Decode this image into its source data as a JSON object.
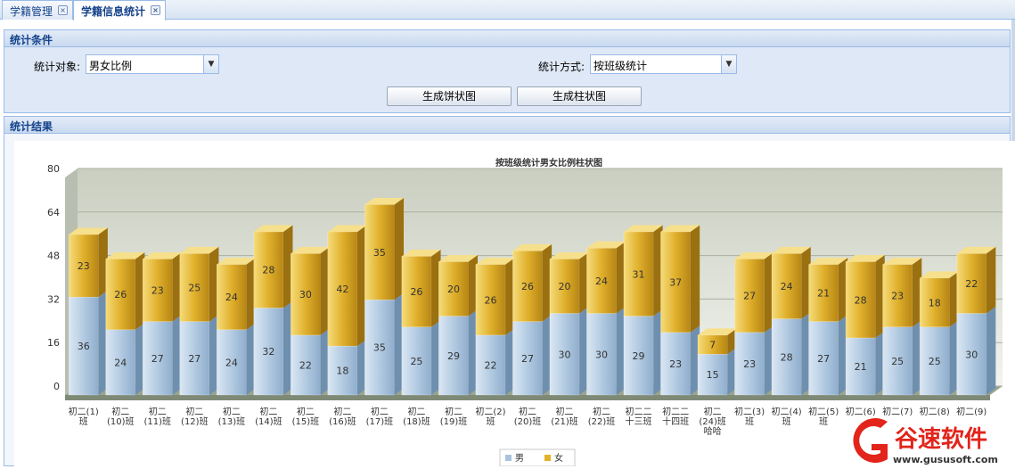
{
  "tabs": [
    {
      "label": "学籍管理",
      "active": false
    },
    {
      "label": "学籍信息统计",
      "active": true
    }
  ],
  "conditions": {
    "header": "统计条件",
    "target_label": "统计对象:",
    "target_value": "男女比例",
    "method_label": "统计方式:",
    "method_value": "按班级统计",
    "pie_button": "生成饼状图",
    "bar_button": "生成柱状图"
  },
  "results": {
    "header": "统计结果"
  },
  "watermark": {
    "text": "谷速软件",
    "url": "www.gususoft.com",
    "color": "#e2241b"
  },
  "chart_data": {
    "type": "bar",
    "stacked": true,
    "title": "按班级统计男女比例柱状图",
    "ylim": [
      0,
      80
    ],
    "yticks": [
      0,
      16,
      32,
      48,
      64,
      80
    ],
    "grid": true,
    "legend_position": "bottom",
    "categories": [
      [
        "初二(1)",
        "班"
      ],
      [
        "初二",
        "(10)班"
      ],
      [
        "初二",
        "(11)班"
      ],
      [
        "初二",
        "(12)班"
      ],
      [
        "初二",
        "(13)班"
      ],
      [
        "初二",
        "(14)班"
      ],
      [
        "初二",
        "(15)班"
      ],
      [
        "初二",
        "(16)班"
      ],
      [
        "初二",
        "(17)班"
      ],
      [
        "初二",
        "(18)班"
      ],
      [
        "初二",
        "(19)班"
      ],
      [
        "初二(2)",
        "班"
      ],
      [
        "初二",
        "(20)班"
      ],
      [
        "初二",
        "(21)班"
      ],
      [
        "初二",
        "(22)班"
      ],
      [
        "初二二",
        "十三班"
      ],
      [
        "初二二",
        "十四班"
      ],
      [
        "初二",
        "(24)班",
        "哈哈"
      ],
      [
        "初二(3)",
        "班"
      ],
      [
        "初二(4)",
        "班"
      ],
      [
        "初二(5)",
        "班"
      ],
      [
        "初二(6)",
        ""
      ],
      [
        "初二(7)",
        ""
      ],
      [
        "初二(8)",
        ""
      ],
      [
        "初二(9)",
        ""
      ]
    ],
    "series": [
      {
        "name": "男",
        "color": "#a9c3dc",
        "values": [
          36,
          24,
          27,
          27,
          24,
          32,
          22,
          18,
          35,
          25,
          29,
          22,
          27,
          30,
          30,
          29,
          23,
          15,
          23,
          28,
          27,
          21,
          25,
          25,
          30
        ]
      },
      {
        "name": "女",
        "color": "#e2b22a",
        "values": [
          23,
          26,
          23,
          25,
          24,
          28,
          30,
          42,
          35,
          26,
          20,
          26,
          26,
          20,
          24,
          31,
          37,
          7,
          27,
          24,
          21,
          28,
          23,
          18,
          22
        ]
      }
    ]
  }
}
